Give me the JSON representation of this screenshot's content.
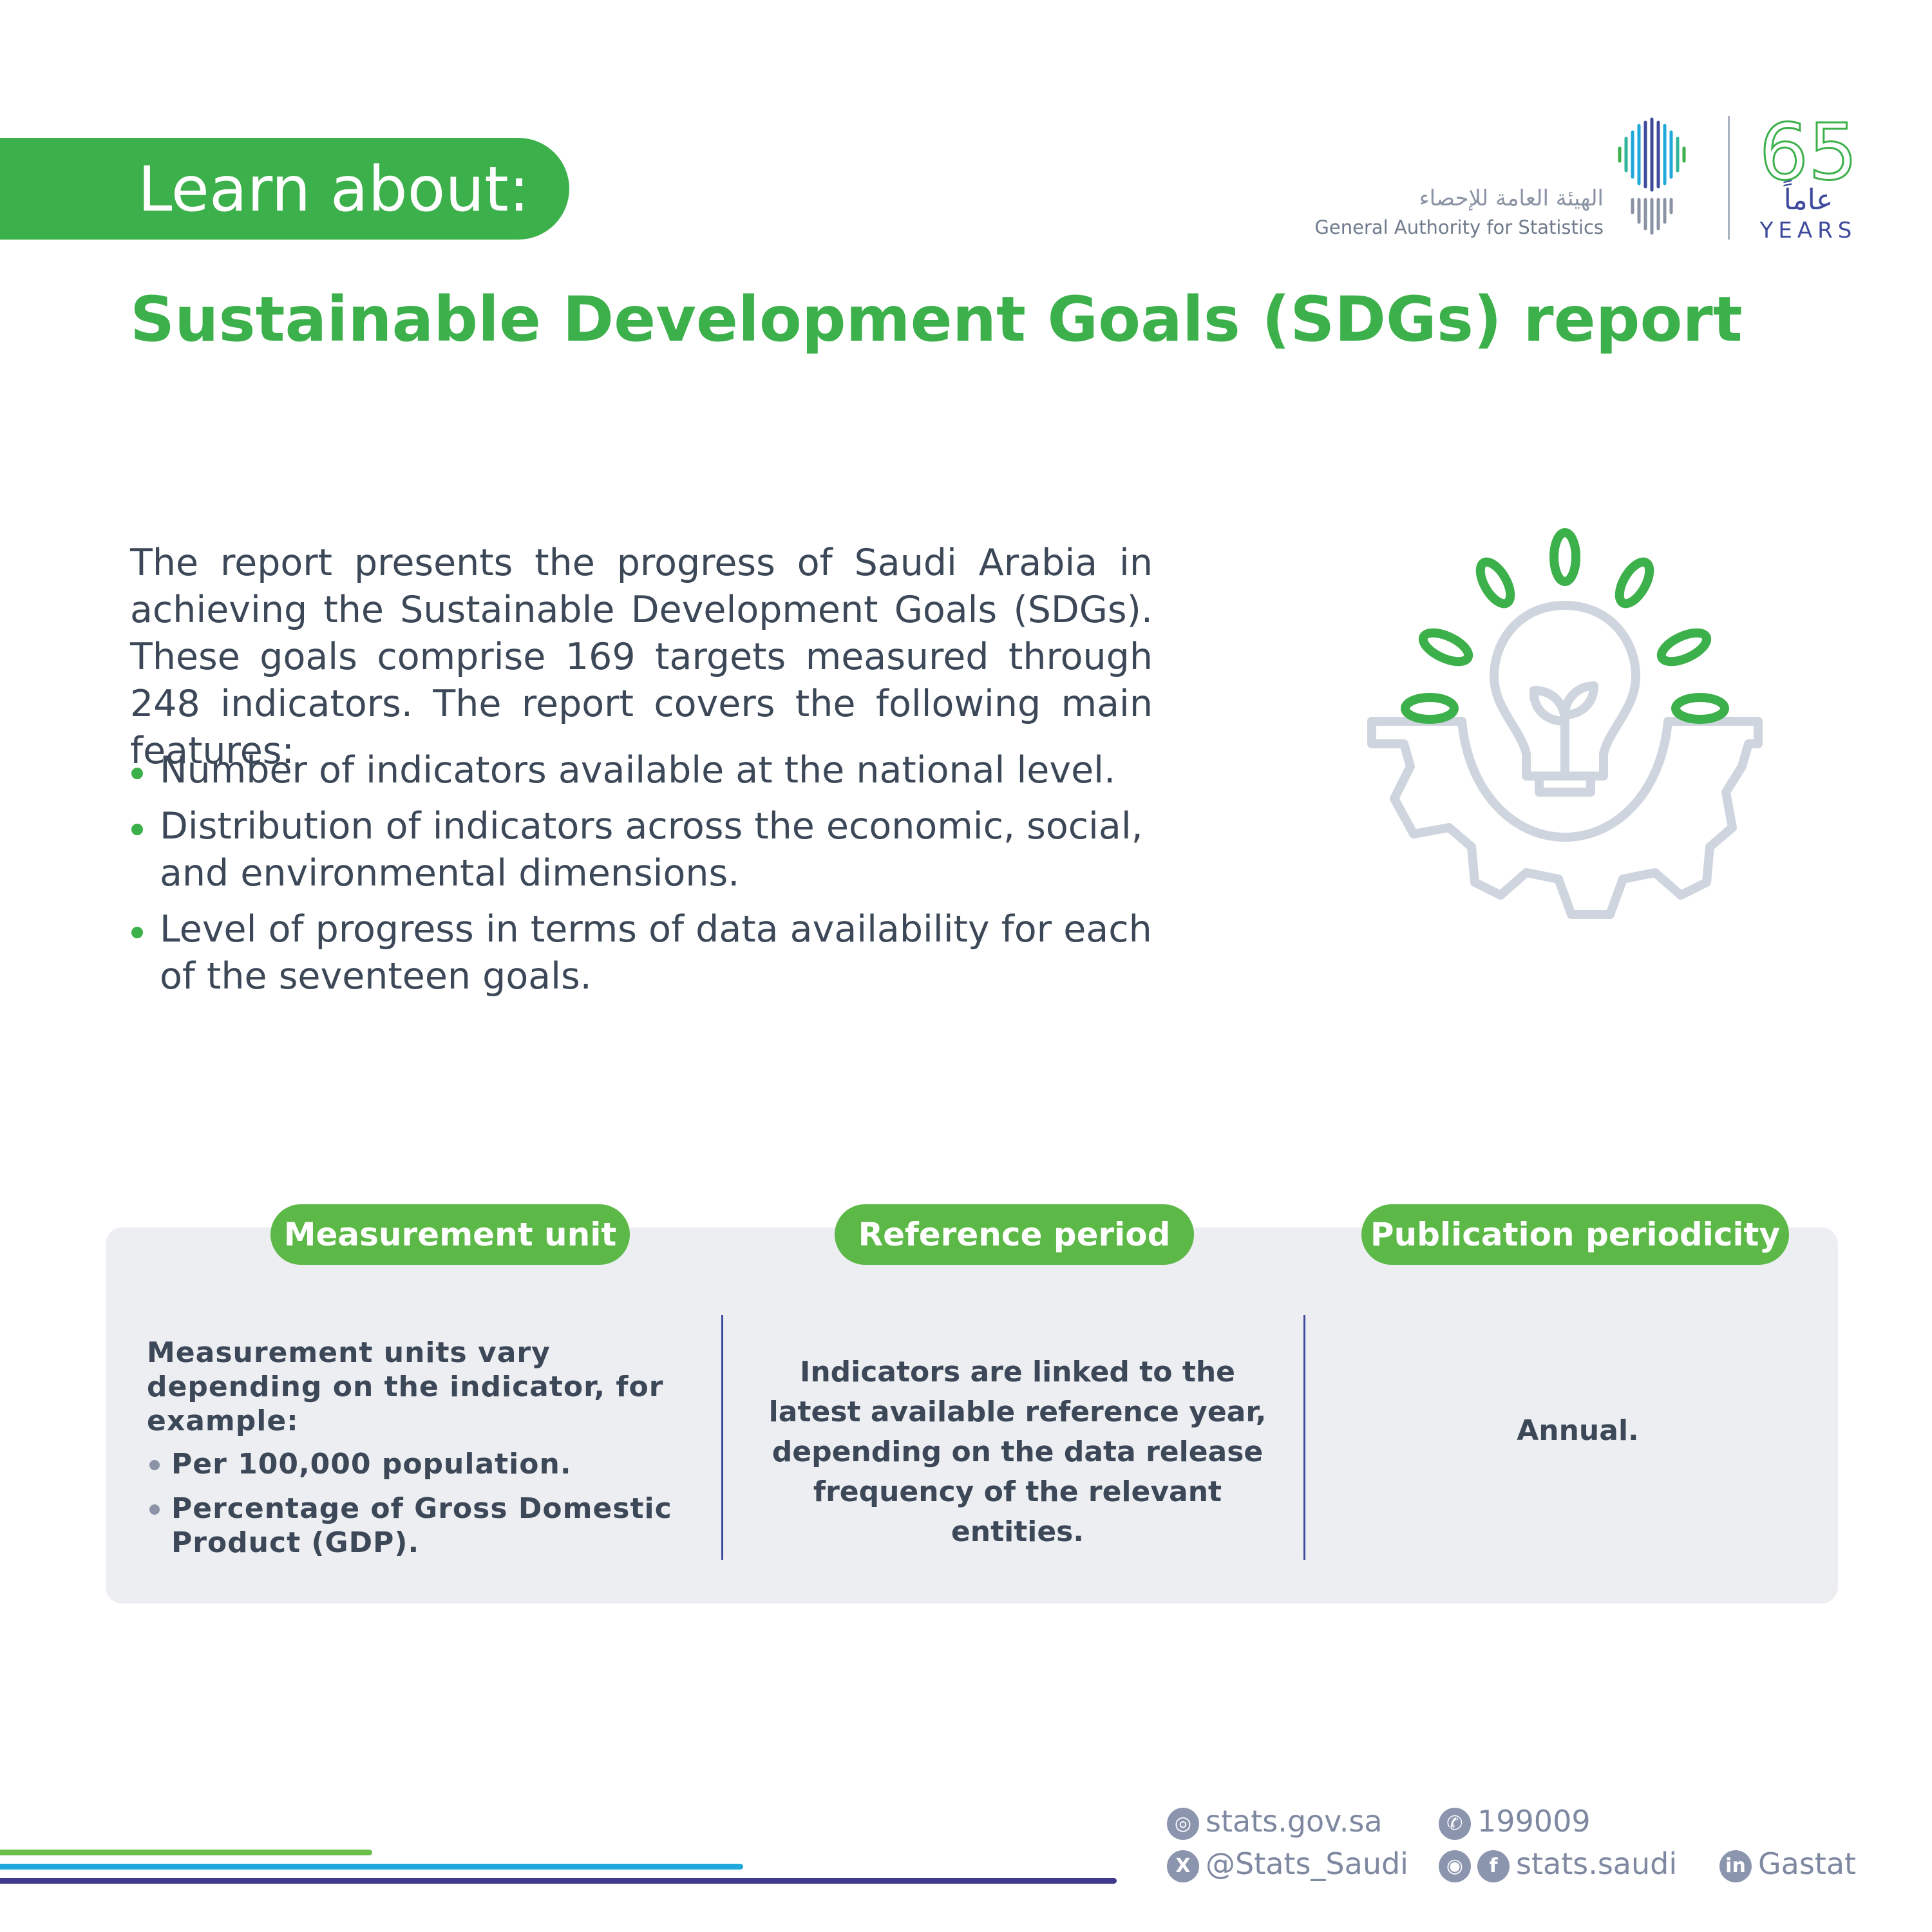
{
  "header": {
    "learn_label": "Learn about:",
    "org_name_ar": "الهيئة العامة للإحصاء",
    "org_name_en": "General Authority for Statistics",
    "anniversary_number": "65",
    "anniversary_ar": "عاماً",
    "anniversary_en": "YEARS"
  },
  "title": "Sustainable Development Goals (SDGs) report",
  "intro": "The report presents the progress of Saudi Arabia in achieving the Sustainable Development Goals (SDGs). These goals comprise 169 targets measured through 248 indicators. The report covers the following main features:",
  "features": [
    "Number of indicators available at the national level.",
    "Distribution of indicators across the economic, social, and environmental dimensions.",
    "Level of progress in terms of data availability for each of the seventeen goals."
  ],
  "panel": {
    "measurement": {
      "tag": "Measurement unit",
      "text": "Measurement units vary depending on the indicator, for example:",
      "items": [
        "Per 100,000 population.",
        "Percentage of Gross Domestic Product (GDP)."
      ]
    },
    "reference": {
      "tag": "Reference period",
      "text": "Indicators are linked to the latest available reference year, depending on the data release frequency of the relevant entities."
    },
    "periodicity": {
      "tag": "Publication periodicity",
      "text": "Annual."
    }
  },
  "footer": {
    "website": "stats.gov.sa",
    "phone": "199009",
    "x_handle": "@Stats_Saudi",
    "social_handle": "stats.saudi",
    "linkedin": "Gastat"
  },
  "colors": {
    "brand_green": "#3cb04a",
    "tag_green": "#5cb847",
    "text_dark": "#3c4757",
    "panel_bg": "#eceef2",
    "accent_purple": "#3f4a9c",
    "accent_blue": "#1fa8dc"
  }
}
